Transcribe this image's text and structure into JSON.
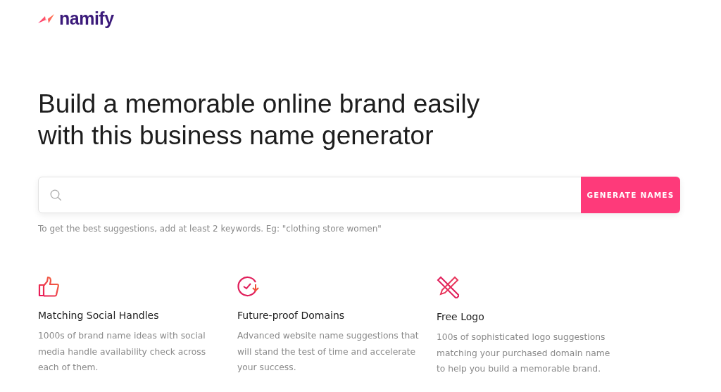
{
  "logo": {
    "text": "namify"
  },
  "heading": "Build a memorable online brand easily with this business name generator",
  "search": {
    "button": "GENERATE NAMES",
    "hint": "To get the best suggestions, add at least 2 keywords. Eg: \"clothing store women\""
  },
  "features": [
    {
      "kind": "thumb",
      "title": "Matching Social Handles",
      "text": "1000s of brand name ideas with social media handle availability check across each of them."
    },
    {
      "kind": "clock",
      "title": "Future-proof Domains",
      "text": "Advanced website name suggestions that will stand the test of time and accelerate your success."
    },
    {
      "kind": "tools",
      "title": "Free Logo",
      "text": "100s of sophisticated logo suggestions matching your purchased domain name to help you build a memorable brand."
    }
  ]
}
